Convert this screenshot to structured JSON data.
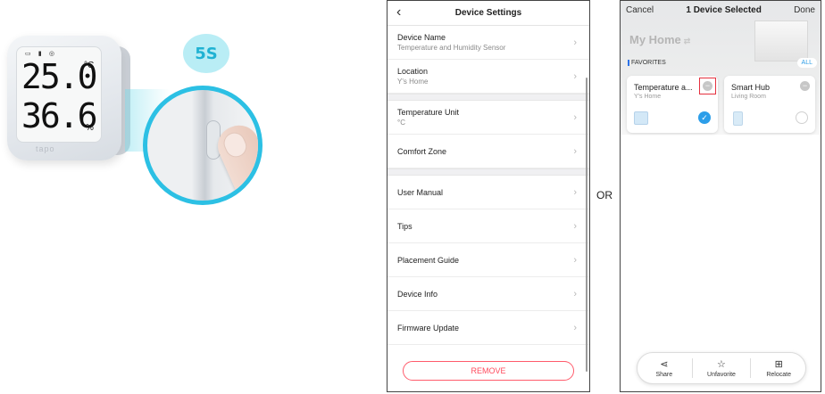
{
  "illustration": {
    "badge": "5S",
    "lcd_temperature": "25.0",
    "lcd_temperature_unit": "°C",
    "lcd_humidity": "36.6",
    "lcd_humidity_unit": "%",
    "logo": "tapo"
  },
  "device_settings": {
    "title": "Device Settings",
    "back_icon": "chevron-left",
    "rows": [
      {
        "label": "Device Name",
        "value": "Temperature and Humidity Sensor"
      },
      {
        "label": "Location",
        "value": "Y's Home"
      },
      {
        "label": "Temperature Unit",
        "value": "°C"
      },
      {
        "label": "Comfort Zone",
        "value": ""
      },
      {
        "label": "User Manual",
        "value": ""
      },
      {
        "label": "Tips",
        "value": ""
      },
      {
        "label": "Placement Guide",
        "value": ""
      },
      {
        "label": "Device Info",
        "value": ""
      },
      {
        "label": "Firmware Update",
        "value": ""
      }
    ],
    "remove_label": "REMOVE",
    "remove_color": "#ff4a5c"
  },
  "separator_label": "OR",
  "home_screen": {
    "cancel_label": "Cancel",
    "selection_title": "1 Device Selected",
    "done_label": "Done",
    "home_title": "My Home",
    "favorites_label": "FAVORITES",
    "all_label": "ALL",
    "cards": [
      {
        "name": "Temperature a...",
        "room": "Y's Home",
        "selected": true
      },
      {
        "name": "Smart Hub",
        "room": "Living Room",
        "selected": false
      }
    ],
    "actions": [
      {
        "label": "Share",
        "icon": "share-icon"
      },
      {
        "label": "Unfavorite",
        "icon": "unfavorite-star-icon"
      },
      {
        "label": "Relocate",
        "icon": "relocate-folder-icon"
      }
    ],
    "accent_color": "#2c9ee9",
    "highlight_color": "#e5313f"
  }
}
